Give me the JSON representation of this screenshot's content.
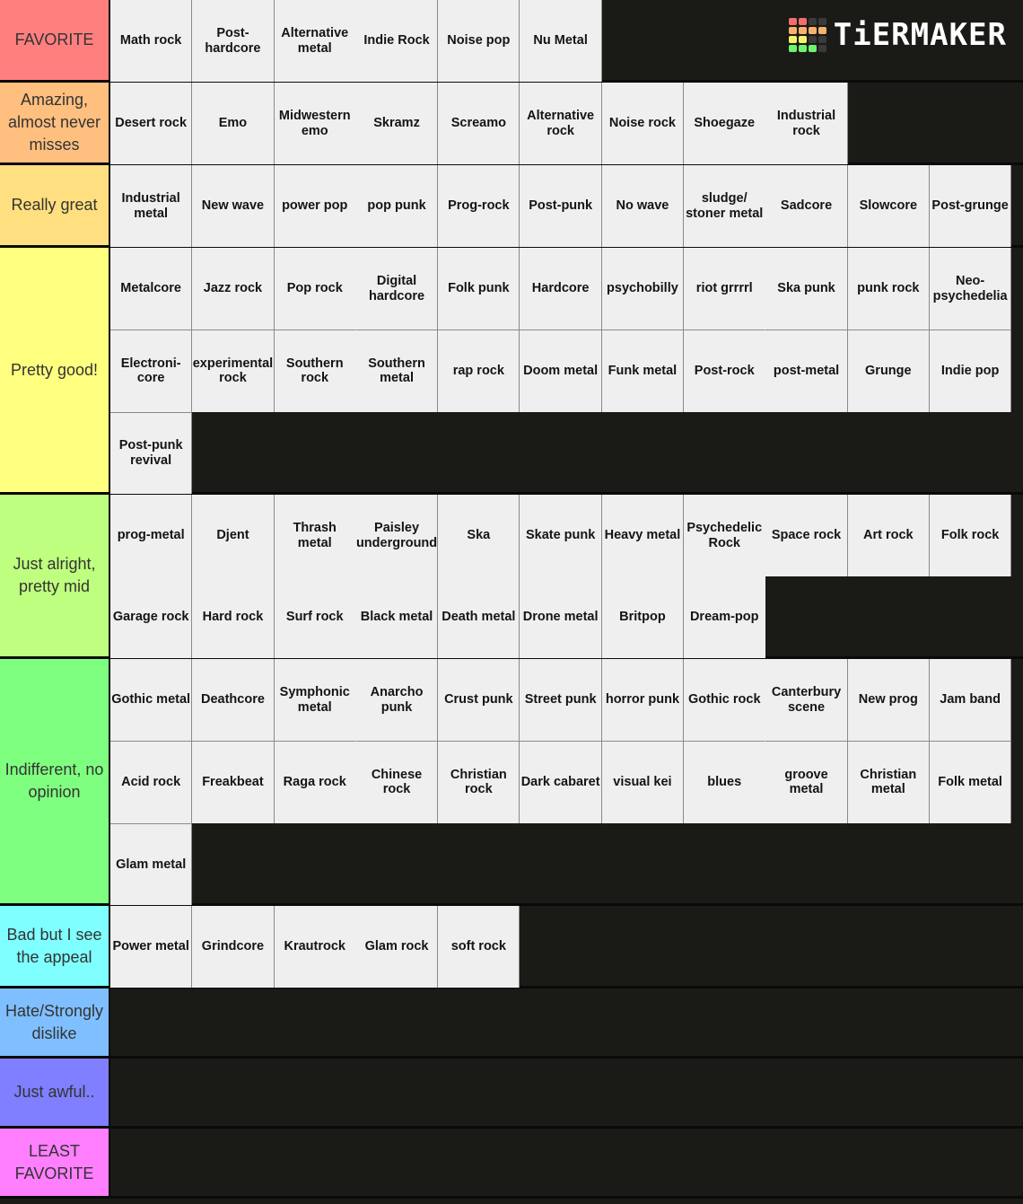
{
  "logo": {
    "text": "TiERMAKER",
    "grid_colors": [
      "#f36d6d",
      "#f36d6d",
      "#3a3a3a",
      "#3a3a3a",
      "#f7b16f",
      "#f7b16f",
      "#f7b16f",
      "#f7b16f",
      "#f7f26d",
      "#f7f26d",
      "#3a3a3a",
      "#3a3a3a",
      "#6df36d",
      "#6df36d",
      "#6df36d",
      "#3a3a3a"
    ]
  },
  "tiers": [
    {
      "label": "FAVORITE",
      "color": "#ff7f7f",
      "rows": 1,
      "items": [
        "Math rock",
        "Post-hardcore",
        "Alternative metal",
        "Indie Rock",
        "Noise pop",
        "Nu Metal"
      ]
    },
    {
      "label": "Amazing, almost never misses",
      "color": "#ffbf7f",
      "rows": 1,
      "items": [
        "Desert rock",
        "Emo",
        "Midwestern emo",
        "Skramz",
        "Screamo",
        "Alternative rock",
        "Noise rock",
        "Shoegaze",
        "Industrial rock"
      ]
    },
    {
      "label": "Really great",
      "color": "#ffdf7f",
      "rows": 1,
      "items": [
        "Industrial metal",
        "New wave",
        "power pop",
        "pop punk",
        "Prog-rock",
        "Post-punk",
        "No wave",
        "sludge/ stoner metal",
        "Sadcore",
        "Slowcore",
        "Post-grunge"
      ]
    },
    {
      "label": "Pretty good!",
      "color": "#ffff7f",
      "rows": 3,
      "items": [
        "Metalcore",
        "Jazz rock",
        "Pop rock",
        "Digital hardcore",
        "Folk punk",
        "Hardcore",
        "psychobilly",
        "riot grrrrl",
        "Ska punk",
        "punk rock",
        "Neo-psychedelia",
        "Electroni-core",
        "experimental rock",
        "Southern rock",
        "Southern metal",
        "rap rock",
        "Doom metal",
        "Funk metal",
        "Post-rock",
        "post-metal",
        "Grunge",
        "Indie pop",
        "Post-punk revival"
      ]
    },
    {
      "label": "Just alright, pretty mid",
      "color": "#bfff7f",
      "rows": 2,
      "items": [
        "prog-metal",
        "Djent",
        "Thrash metal",
        "Paisley underground",
        "Ska",
        "Skate punk",
        "Heavy metal",
        "Psychedelic Rock",
        "Space rock",
        "Art rock",
        "Folk rock",
        "Garage rock",
        "Hard rock",
        "Surf rock",
        "Black metal",
        "Death metal",
        "Drone metal",
        "Britpop",
        "Dream-pop"
      ]
    },
    {
      "label": "Indifferent, no opinion",
      "color": "#7fff7f",
      "rows": 3,
      "items": [
        "Gothic metal",
        "Deathcore",
        "Symphonic metal",
        "Anarcho punk",
        "Crust punk",
        "Street punk",
        "horror punk",
        "Gothic rock",
        "Canterbury scene",
        "New prog",
        "Jam band",
        "Acid rock",
        "Freakbeat",
        "Raga rock",
        "Chinese rock",
        "Christian rock",
        "Dark cabaret",
        "visual kei",
        "blues",
        "groove metal",
        "Christian metal",
        "Folk metal",
        "Glam metal"
      ]
    },
    {
      "label": "Bad but I see the appeal",
      "color": "#7fffff",
      "rows": 1,
      "items": [
        "Power metal",
        "Grindcore",
        "Krautrock",
        "Glam rock",
        "soft rock"
      ]
    },
    {
      "label": "Hate/Strongly dislike",
      "color": "#7fbfff",
      "rows": 1,
      "items": []
    },
    {
      "label": "Just awful..",
      "color": "#7f7fff",
      "rows": 1,
      "items": []
    },
    {
      "label": "LEAST FAVORITE",
      "color": "#ff7fff",
      "rows": 1,
      "items": []
    }
  ]
}
